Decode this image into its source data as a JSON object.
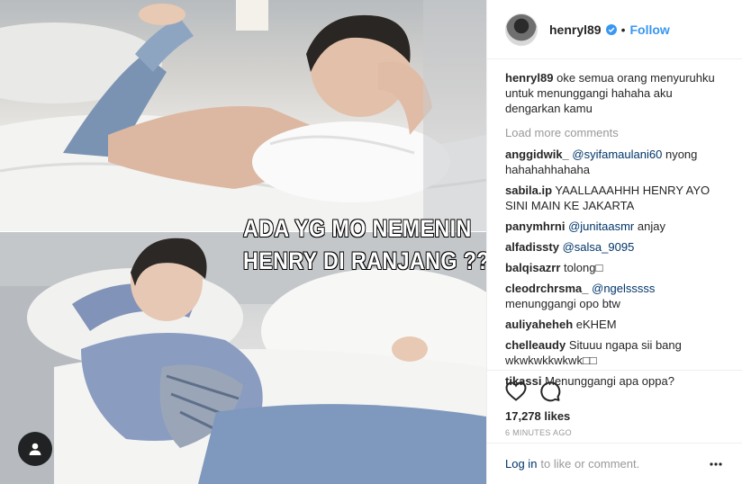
{
  "post": {
    "overlay_text": [
      "ADA YG MO NEMENIN",
      "HENRY DI RANJANG ???"
    ],
    "header": {
      "username": "henryl89",
      "follow_label": "Follow",
      "separator": "•"
    },
    "caption": {
      "username": "henryl89",
      "text": "oke semua orang menyuruhku untuk menunggangi hahaha aku dengarkan kamu"
    },
    "load_more_label": "Load more comments",
    "comments": [
      {
        "username": "anggidwik_",
        "text": "nyong hahahahhahaha",
        "mention": "@syifamaulani60"
      },
      {
        "username": "sabila.ip",
        "text": "YAALLAAAHHH HENRY AYO SINI MAIN KE JAKARTA",
        "mention": ""
      },
      {
        "username": "panymhrni",
        "text": "anjay",
        "mention": "@junitaasmr"
      },
      {
        "username": "alfadissty",
        "text": "",
        "mention": "@salsa_9095"
      },
      {
        "username": "balqisazrr",
        "text": "tolong□",
        "mention": ""
      },
      {
        "username": "cleodrchrsma_",
        "text": "menunggangi opo btw",
        "mention": "@ngelsssss"
      },
      {
        "username": "auliyaheheh",
        "text": "eKHEM",
        "mention": ""
      },
      {
        "username": "chelleaudy",
        "text": "Situuu ngapa sii bang wkwkwkkwkwk□□",
        "mention": ""
      },
      {
        "username": "tikassi",
        "text": "Menunggangi apa oppa?",
        "mention": ""
      }
    ],
    "likes_label": "17,278 likes",
    "time_label": "6 MINUTES AGO",
    "login_link": "Log in",
    "login_rest": "to like or comment.",
    "icons": {
      "like": "heart-icon",
      "comment": "comment-icon",
      "more": "more-options-icon",
      "verified": "verified-badge-icon",
      "tag": "user-tag-icon"
    },
    "colors": {
      "accent": "#3897f0",
      "link": "#003569",
      "muted": "#999999",
      "text": "#262626"
    }
  }
}
